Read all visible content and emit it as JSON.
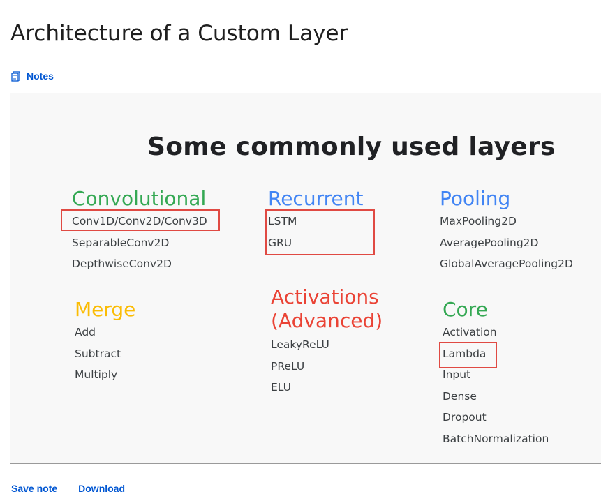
{
  "page": {
    "title": "Architecture of a Custom Layer"
  },
  "notes": {
    "label": "Notes",
    "icon": "notes-icon"
  },
  "slide": {
    "title": "Some commonly used layers",
    "groups": {
      "convolutional": {
        "title": "Convolutional",
        "color": "#34a853",
        "items": [
          "Conv1D/Conv2D/Conv3D",
          "SeparableConv2D",
          "DepthwiseConv2D"
        ]
      },
      "recurrent": {
        "title": "Recurrent",
        "color": "#4285f4",
        "items": [
          "LSTM",
          "GRU"
        ]
      },
      "pooling": {
        "title": "Pooling",
        "color": "#4285f4",
        "items": [
          "MaxPooling2D",
          "AveragePooling2D",
          "GlobalAveragePooling2D"
        ]
      },
      "merge": {
        "title": "Merge",
        "color": "#fbbc04",
        "items": [
          "Add",
          "Subtract",
          "Multiply"
        ]
      },
      "activations": {
        "title_line1": "Activations",
        "title_line2": "(Advanced)",
        "color": "#ea4335",
        "items": [
          "LeakyReLU",
          "PReLU",
          "ELU"
        ]
      },
      "core": {
        "title": "Core",
        "color": "#34a853",
        "items": [
          "Activation",
          "Lambda",
          "Input",
          "Dense",
          "Dropout",
          "BatchNormalization"
        ]
      }
    },
    "highlight_color": "#e04a43"
  },
  "bottom": {
    "save_note": "Save note",
    "download": "Download"
  }
}
